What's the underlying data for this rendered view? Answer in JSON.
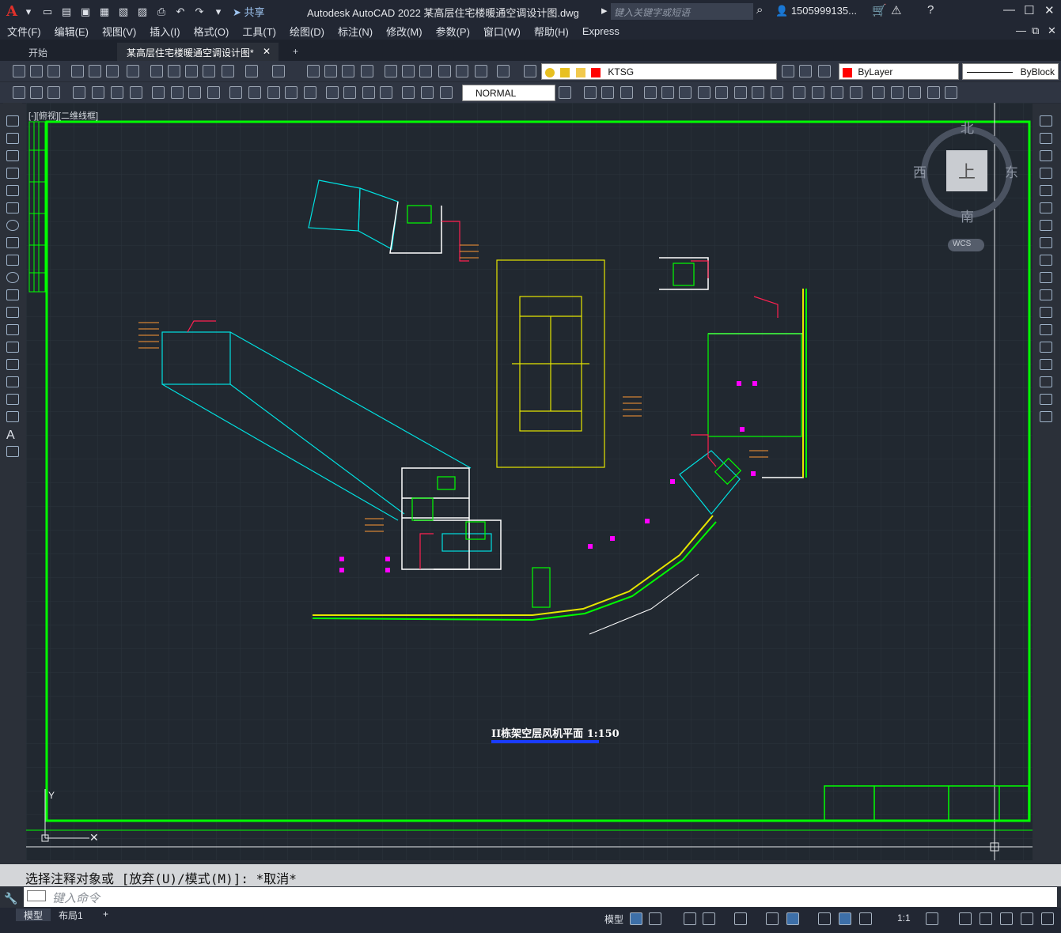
{
  "app": {
    "logo": "A",
    "title": "Autodesk AutoCAD 2022    某高层住宅楼暖通空调设计图.dwg",
    "share_label": "共享",
    "search_placeholder": "键入关键字或短语",
    "user": "1505999135...",
    "colors": {
      "accent": "#e0312b",
      "drawing_frame": "#00ff00",
      "canvas": "#212830"
    }
  },
  "menu": [
    "文件(F)",
    "编辑(E)",
    "视图(V)",
    "插入(I)",
    "格式(O)",
    "工具(T)",
    "绘图(D)",
    "标注(N)",
    "修改(M)",
    "参数(P)",
    "窗口(W)",
    "帮助(H)",
    "Express"
  ],
  "tabs": {
    "start": "开始",
    "document": "某高层住宅楼暖通空调设计图*",
    "close": "✕",
    "new": "+"
  },
  "layer": {
    "current": "KTSG",
    "color": "#ff0000"
  },
  "properties": {
    "color": "ByLayer",
    "linetype": "ByBlock"
  },
  "style": {
    "dimstyle": "NORMAL"
  },
  "viewport": {
    "label": "[-][俯视][二维线框]"
  },
  "viewcube": {
    "north": "北",
    "south": "南",
    "east": "东",
    "west": "西",
    "face": "上",
    "wcs": "WCS"
  },
  "drawing": {
    "title": "II栋架空层风机平面 1:150"
  },
  "command": {
    "history": "选择注释对象或 [放弃(U)/模式(M)]: *取消*",
    "placeholder": "键入命令"
  },
  "layouts": [
    "模型",
    "布局1"
  ],
  "statusbar": {
    "model": "模型",
    "scale": "1:1"
  }
}
